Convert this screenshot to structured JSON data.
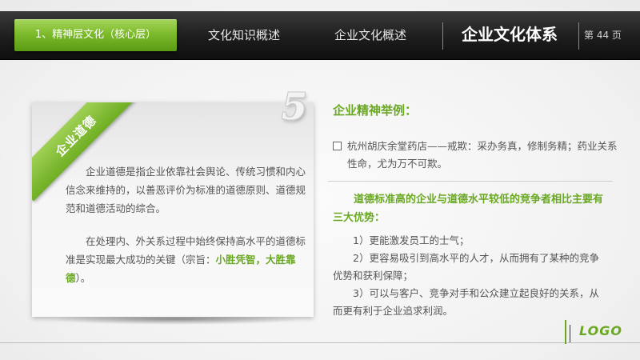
{
  "nav": {
    "active_tab": "1、精神层文化（核心层）",
    "tabs": [
      "文化知识概述",
      "企业文化概述"
    ],
    "title": "企业文化体系",
    "page": "第 44 页"
  },
  "card": {
    "ribbon": "企业道德",
    "para1": "企业道德是指企业依靠社会舆论、传统习惯和内心信念来维持的，以善恶评价为标准的道德原则、道德规范和道德活动的综合。",
    "para2_prefix": "在处理内、外关系过程中始终保持高水平的道德标准是实现最大成功的关键（宗旨：",
    "para2_highlight": "小胜凭智，大胜靠德",
    "para2_suffix": "）。"
  },
  "big_number": "5",
  "right": {
    "heading": "企业精神举例：",
    "example": "杭州胡庆余堂药店——戒欺：采办务真，修制务精；药业关系性命，尤为万不可欺。",
    "sub_heading": "道德标准高的企业与道德水平较低的竞争者相比主要有三大优势：",
    "advantages": [
      "1）更能激发员工的士气；",
      "2）更容易吸引到高水平的人才，从而拥有了某种的竞争优势和获利保障；",
      "3）可以与客户、竞争对手和公众建立起良好的关系，从而更有利于企业追求利润。"
    ]
  },
  "footer": {
    "logo": "LOGO"
  },
  "colors": {
    "accent": "#6aa823",
    "bar": "#1d1d1d"
  }
}
